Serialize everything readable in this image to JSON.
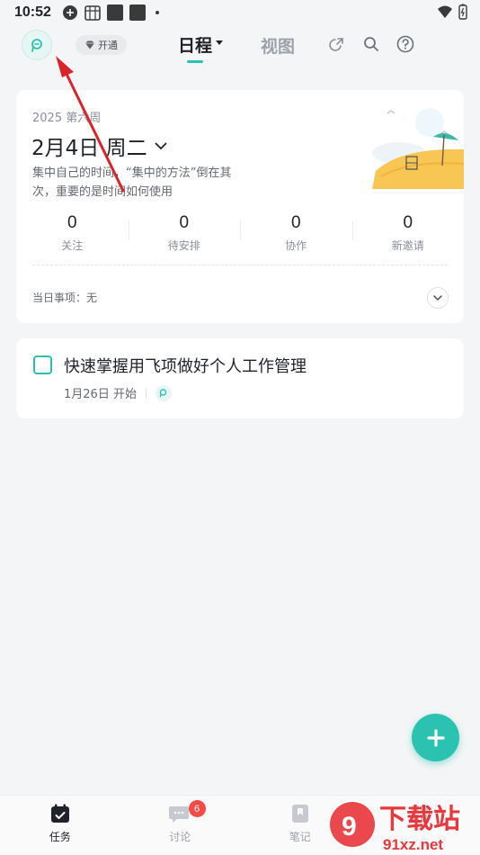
{
  "status_bar": {
    "time": "10:52"
  },
  "header": {
    "vip_label": "开通",
    "tab_schedule": "日程",
    "tab_view": "视图",
    "icons": [
      "share-icon",
      "search-icon",
      "help-icon"
    ]
  },
  "date_card": {
    "week_label": "2025 第六周",
    "date_title": "2月4日 周二",
    "quote": "集中自己的时间，“集中的方法”倒在其次，重要的是时间如何使用",
    "stats": [
      {
        "value": "0",
        "label": "关注"
      },
      {
        "value": "0",
        "label": "待安排"
      },
      {
        "value": "0",
        "label": "协作"
      },
      {
        "value": "0",
        "label": "新邀请"
      }
    ],
    "today_label": "当日事项：无"
  },
  "task": {
    "title": "快速掌握用飞项做好个人工作管理",
    "start_label": "1月26日 开始"
  },
  "bottom_nav": {
    "items": [
      {
        "label": "任务",
        "icon": "calendar-check-icon",
        "active": true
      },
      {
        "label": "讨论",
        "icon": "chat-bubble-icon",
        "badge": "6"
      },
      {
        "label": "笔记",
        "icon": "bookmark-note-icon"
      },
      {
        "label": "",
        "icon": "more-icon"
      }
    ]
  },
  "watermark": {
    "line1": "下载站",
    "line2": "91xz.net"
  },
  "colors": {
    "accent": "#2cc2b2",
    "badge": "#f54a45",
    "annotation": "#d9252a",
    "background": "#f4f5f7"
  }
}
